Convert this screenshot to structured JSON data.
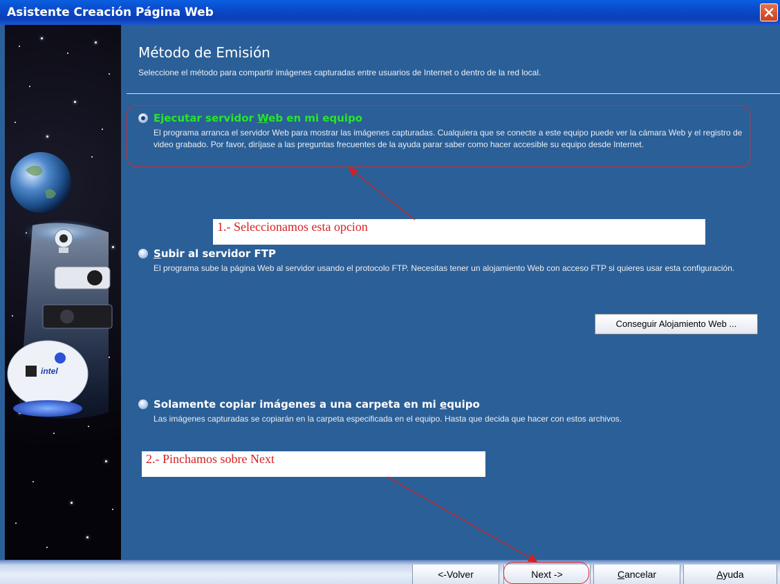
{
  "window": {
    "title": "Asistente Creación Página Web"
  },
  "page": {
    "title": "Método de Emisión",
    "subtitle": "Seleccione el método para compartir imágenes capturadas entre usuarios de Internet o dentro de la red local."
  },
  "options": [
    {
      "label_prefix": "Ejecutar servidor ",
      "label_accel": "W",
      "label_suffix": "eb en mi equipo",
      "checked": true,
      "description": "El programa arranca el servidor Web para mostrar las imágenes capturadas. Cualquiera que se conecte a este equipo puede ver la cámara Web y el registro de video grabado. Por favor, diríjase a las preguntas frecuentes de la ayuda parar saber como hacer accesible su equipo desde Internet."
    },
    {
      "label_prefix": "",
      "label_accel": "S",
      "label_suffix": "ubir al servidor FTP",
      "checked": false,
      "description": "El programa sube la página Web al servidor usando el protocolo FTP. Necesitas tener un alojamiento Web con acceso FTP si quieres usar esta configuración."
    },
    {
      "label_prefix": "Solamente copiar imágenes a una carpeta en mi ",
      "label_accel": "e",
      "label_suffix": "quipo",
      "checked": false,
      "description": "Las imágenes capturadas se copiarán en la carpeta especificada en el equipo. Hasta que decida que hacer con estos archivos."
    }
  ],
  "hosting_button": "Conseguir Alojamiento Web ...",
  "annotations": {
    "step1": "1.- Seleccionamos esta opcion",
    "step2": "2.- Pinchamos sobre Next"
  },
  "nav": {
    "back": "<-Volver",
    "next": "Next ->",
    "cancel_accel": "C",
    "cancel_rest": "ancelar",
    "help_accel": "A",
    "help_rest": "yuda"
  },
  "colors": {
    "accent": "#2b5f97",
    "selected_label": "#28e52a",
    "annotation": "#d62020"
  }
}
